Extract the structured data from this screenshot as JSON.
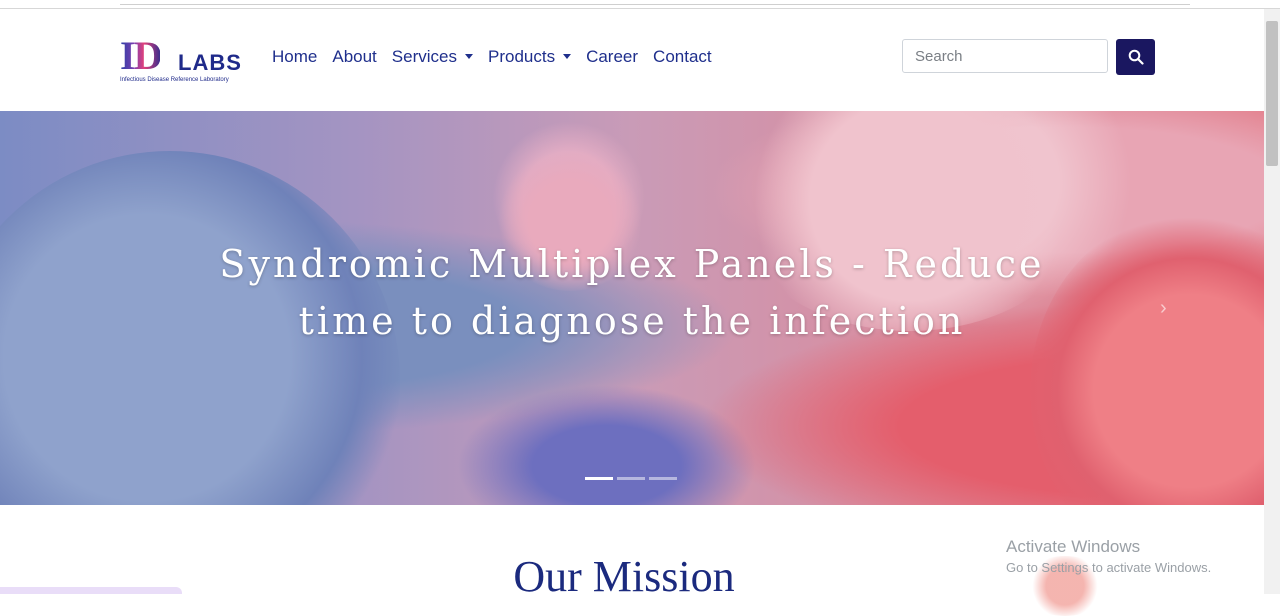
{
  "brand": {
    "logo_mark": "ID",
    "logo_word": "LABS",
    "logo_tagline": "Infectious Disease Reference Laboratory"
  },
  "nav": {
    "items": [
      {
        "label": "Home",
        "dropdown": false
      },
      {
        "label": "About",
        "dropdown": false
      },
      {
        "label": "Services",
        "dropdown": true
      },
      {
        "label": "Products",
        "dropdown": true
      },
      {
        "label": "Career",
        "dropdown": false
      },
      {
        "label": "Contact",
        "dropdown": false
      }
    ]
  },
  "search": {
    "placeholder": "Search",
    "value": "",
    "button_icon": "search-icon"
  },
  "hero": {
    "title_line1": "Syndromic Multiplex Panels - Reduce",
    "title_line2": "time to diagnose the infection",
    "slide_count": 3,
    "active_slide": 1
  },
  "mission": {
    "heading": "Our Mission"
  },
  "watermark": {
    "line1": "Activate Windows",
    "line2": "Go to Settings to activate Windows."
  },
  "colors": {
    "brand_navy": "#1a1760",
    "nav_text": "#1f2f8c",
    "heading": "#1b2a7e"
  }
}
